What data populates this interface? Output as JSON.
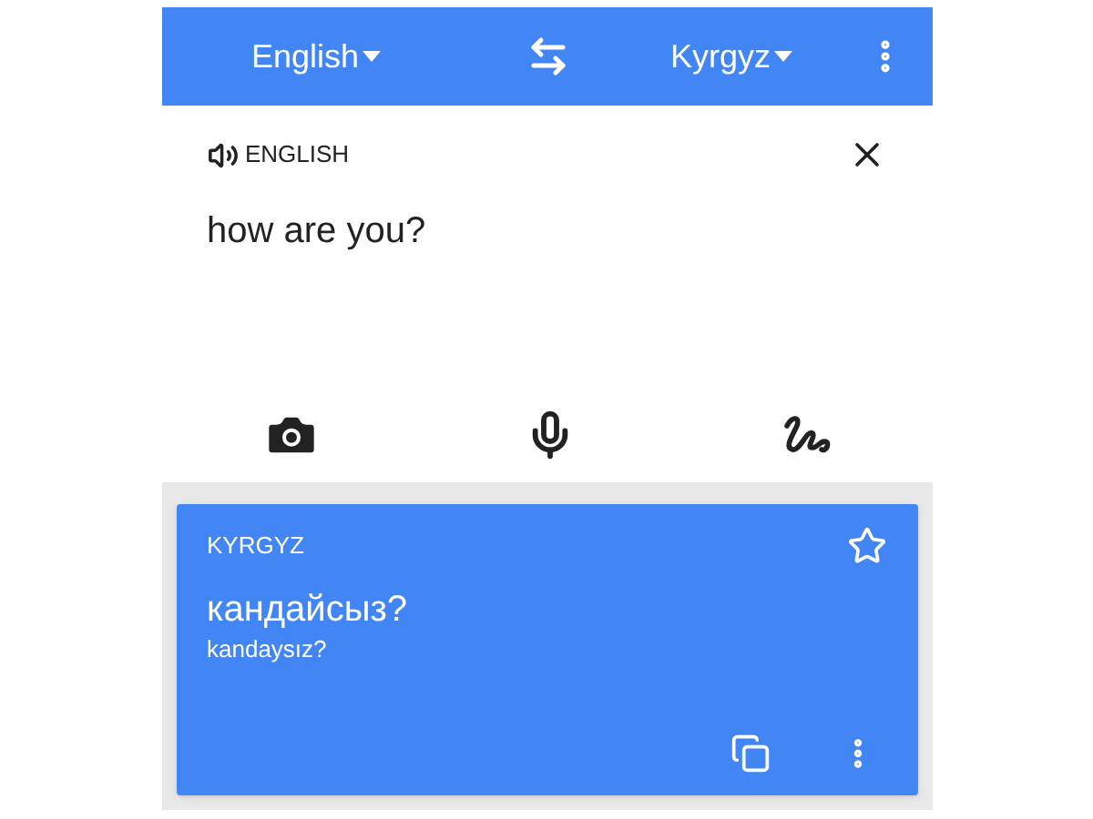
{
  "toolbar": {
    "source_language": "English",
    "target_language": "Kyrgyz"
  },
  "input": {
    "language_label": "ENGLISH",
    "text": "how are you?"
  },
  "result": {
    "language_label": "KYRGYZ",
    "translation": "кандайсыз?",
    "transliteration": "kandaysız?"
  }
}
